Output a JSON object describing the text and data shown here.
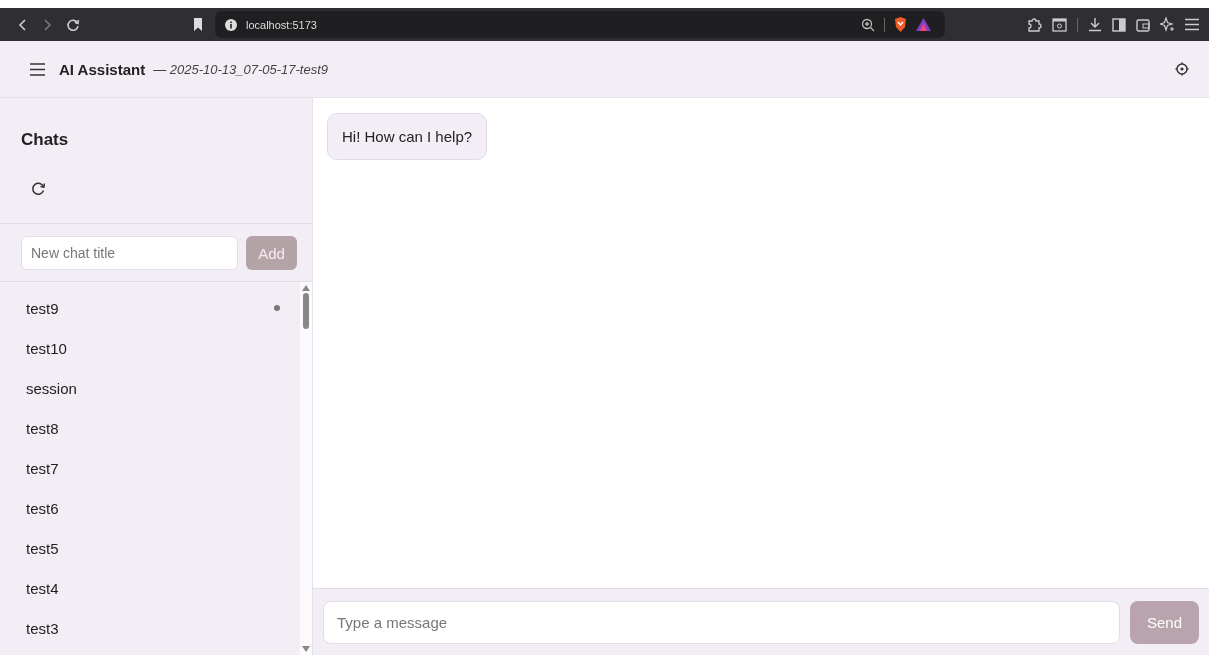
{
  "browser": {
    "url": "localhost:5173"
  },
  "header": {
    "title": "AI Assistant",
    "subtitle": "— 2025-10-13_07-05-17-test9"
  },
  "sidebar": {
    "heading": "Chats",
    "new_chat": {
      "placeholder": "New chat title",
      "button": "Add",
      "disabled": true
    },
    "chats": [
      {
        "title": "test9",
        "active": true
      },
      {
        "title": "test10",
        "active": false
      },
      {
        "title": "session",
        "active": false
      },
      {
        "title": "test8",
        "active": false
      },
      {
        "title": "test7",
        "active": false
      },
      {
        "title": "test6",
        "active": false
      },
      {
        "title": "test5",
        "active": false
      },
      {
        "title": "test4",
        "active": false
      },
      {
        "title": "test3",
        "active": false
      }
    ]
  },
  "messages": [
    {
      "text": "Hi! How can I help?"
    }
  ],
  "composer": {
    "placeholder": "Type a message",
    "button": "Send",
    "disabled": true
  }
}
